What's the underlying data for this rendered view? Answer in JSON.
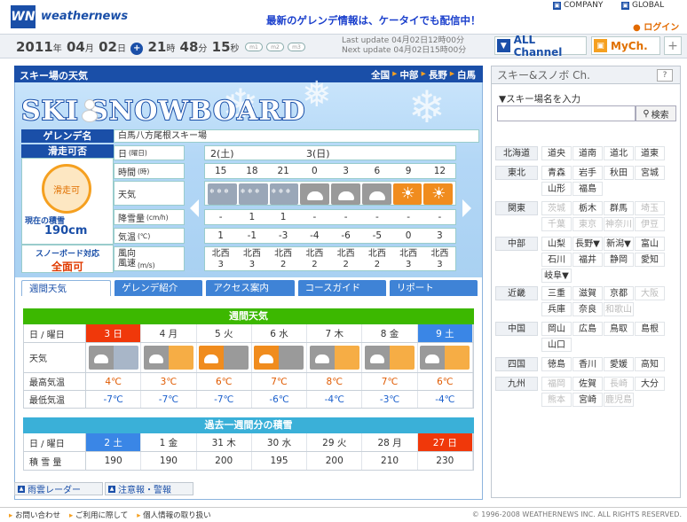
{
  "header": {
    "logo_mark": "WN",
    "logo_text": "weathernews",
    "promo": "最新のゲレンデ情報は、ケータイでも配信中！",
    "company": "COMPANY",
    "global": "GLOBAL",
    "login": "ログイン"
  },
  "datebar": {
    "year": "2011",
    "month": "04",
    "day": "02",
    "hour": "21",
    "minute": "48",
    "second": "15",
    "u_year": "年",
    "u_month": "月",
    "u_day": "日",
    "u_hour": "時",
    "u_minute": "分",
    "u_second": "秒",
    "last_update": "Last update  04月02日12時00分",
    "next_update": "Next update  04月02日15時00分",
    "clock_btns": [
      "m1",
      "m2",
      "m3"
    ]
  },
  "channels": {
    "all": "ALL Channel",
    "my": "MyCh.",
    "plus": "+"
  },
  "panel": {
    "title": "スキー場の天気",
    "breadcrumb": [
      "全国",
      "中部",
      "長野",
      "白馬"
    ],
    "hero_title": "SKI SNOWBOARD"
  },
  "resort": {
    "name_label": "ゲレンデ名",
    "name": "白馬八方尾根スキー場",
    "status_label": "滑走可否",
    "status_value": "滑走可",
    "snow_label": "現在の積雪",
    "snow_value": "190cm",
    "sb_label": "スノーボード対応",
    "sb_value": "全面可"
  },
  "forecast": {
    "rows": {
      "date": "日",
      "date_sub": "(曜日)",
      "time": "時間",
      "time_sub": "(時)",
      "weather": "天気",
      "precip": "降雪量",
      "precip_sub": "(cm/h)",
      "temp": "気温",
      "temp_sub": "(℃)",
      "wind": "風向\n風速",
      "wind_sub": "(m/s)"
    },
    "days": [
      "2(土)",
      "3(日)"
    ],
    "times": [
      "15",
      "18",
      "21",
      "0",
      "3",
      "6",
      "9",
      "12"
    ],
    "weather": [
      "snow",
      "snow",
      "snow",
      "cloud",
      "cloud",
      "cloud",
      "sun",
      "sun"
    ],
    "precip": [
      "-",
      "1",
      "1",
      "-",
      "-",
      "-",
      "-",
      "-"
    ],
    "temp": [
      "1",
      "-1",
      "-3",
      "-4",
      "-6",
      "-5",
      "0",
      "3"
    ],
    "wind_dir": [
      "北西",
      "北西",
      "北西",
      "北西",
      "北西",
      "北西",
      "北西",
      "北西"
    ],
    "wind_speed": [
      "3",
      "3",
      "2",
      "2",
      "2",
      "2",
      "3",
      "3"
    ]
  },
  "tabs": [
    "週間天気",
    "ゲレンデ紹介",
    "アクセス案内",
    "コースガイド",
    "リポート"
  ],
  "weekly": {
    "header": "週間天気",
    "label_day": "日 / 曜日",
    "label_weather": "天気",
    "label_high": "最高気温",
    "label_low": "最低気温",
    "days": [
      "3 日",
      "4 月",
      "5 火",
      "6 水",
      "7 木",
      "8 金",
      "9 土"
    ],
    "icons": [
      "cloud-snow",
      "cloud-sun",
      "sun-cloud",
      "sun-cloud",
      "cloud-sun",
      "cloud-sun",
      "cloud-sun"
    ],
    "high": [
      "4℃",
      "3℃",
      "6℃",
      "7℃",
      "8℃",
      "7℃",
      "6℃"
    ],
    "low": [
      "-7℃",
      "-7℃",
      "-7℃",
      "-6℃",
      "-4℃",
      "-3℃",
      "-4℃"
    ]
  },
  "accum": {
    "header": "過去一週間分の積雪",
    "label_day": "日 / 曜日",
    "label_snow": "積 雪 量",
    "days": [
      "2 土",
      "1 金",
      "31 木",
      "30 水",
      "29 火",
      "28 月",
      "27 日"
    ],
    "values": [
      "190",
      "190",
      "200",
      "195",
      "200",
      "210",
      "230"
    ]
  },
  "buttons": {
    "radar": "雨雲レーダー",
    "warning": "注意報・警報"
  },
  "sidebar": {
    "title": "スキー&スノボ Ch.",
    "help": "?",
    "search_label": "▼スキー場名を入力",
    "search_btn": "検索",
    "regions": [
      {
        "name": "北海道",
        "prefs": [
          {
            "n": "道央",
            "d": false
          },
          {
            "n": "道南",
            "d": false
          },
          {
            "n": "道北",
            "d": false
          },
          {
            "n": "道東",
            "d": false
          }
        ]
      },
      {
        "name": "東北",
        "prefs": [
          {
            "n": "青森",
            "d": false
          },
          {
            "n": "岩手",
            "d": false
          },
          {
            "n": "秋田",
            "d": false
          },
          {
            "n": "宮城",
            "d": false
          },
          {
            "n": "山形",
            "d": false
          },
          {
            "n": "福島",
            "d": false
          }
        ]
      },
      {
        "name": "関東",
        "prefs": [
          {
            "n": "茨城",
            "d": true
          },
          {
            "n": "栃木",
            "d": false
          },
          {
            "n": "群馬",
            "d": false
          },
          {
            "n": "埼玉",
            "d": true
          },
          {
            "n": "千葉",
            "d": true
          },
          {
            "n": "東京",
            "d": true
          },
          {
            "n": "神奈川",
            "d": true
          },
          {
            "n": "伊豆",
            "d": true
          }
        ]
      },
      {
        "name": "中部",
        "prefs": [
          {
            "n": "山梨",
            "d": false
          },
          {
            "n": "長野▼",
            "d": false
          },
          {
            "n": "新潟▼",
            "d": false
          },
          {
            "n": "富山",
            "d": false
          },
          {
            "n": "石川",
            "d": false
          },
          {
            "n": "福井",
            "d": false
          },
          {
            "n": "静岡",
            "d": false
          },
          {
            "n": "愛知",
            "d": false
          },
          {
            "n": "岐阜▼",
            "d": false
          }
        ]
      },
      {
        "name": "近畿",
        "prefs": [
          {
            "n": "三重",
            "d": false
          },
          {
            "n": "滋賀",
            "d": false
          },
          {
            "n": "京都",
            "d": false
          },
          {
            "n": "大阪",
            "d": true
          },
          {
            "n": "兵庫",
            "d": false
          },
          {
            "n": "奈良",
            "d": false
          },
          {
            "n": "和歌山",
            "d": true
          }
        ]
      },
      {
        "name": "中国",
        "prefs": [
          {
            "n": "岡山",
            "d": false
          },
          {
            "n": "広島",
            "d": false
          },
          {
            "n": "鳥取",
            "d": false
          },
          {
            "n": "島根",
            "d": false
          },
          {
            "n": "山口",
            "d": false
          }
        ]
      },
      {
        "name": "四国",
        "prefs": [
          {
            "n": "徳島",
            "d": false
          },
          {
            "n": "香川",
            "d": false
          },
          {
            "n": "愛媛",
            "d": false
          },
          {
            "n": "高知",
            "d": false
          }
        ]
      },
      {
        "name": "九州",
        "prefs": [
          {
            "n": "福岡",
            "d": true
          },
          {
            "n": "佐賀",
            "d": false
          },
          {
            "n": "長崎",
            "d": true
          },
          {
            "n": "大分",
            "d": false
          },
          {
            "n": "熊本",
            "d": true
          },
          {
            "n": "宮崎",
            "d": false
          },
          {
            "n": "鹿児島",
            "d": true
          }
        ]
      }
    ]
  },
  "footer": {
    "links": [
      "お問い合わせ",
      "ご利用に際して",
      "個人情報の取り扱い"
    ],
    "copyright": "© 1996-2008 WEATHERNEWS INC. ALL RIGHTS RESERVED."
  }
}
